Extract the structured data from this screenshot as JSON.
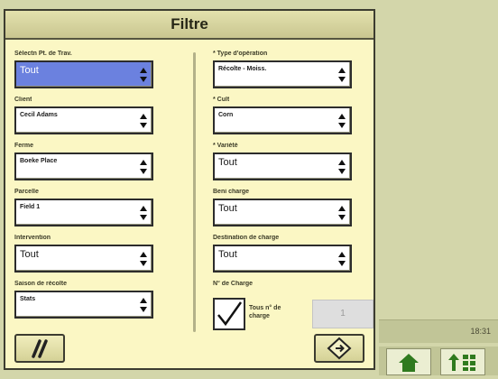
{
  "dialog": {
    "title": "Filtre"
  },
  "left_column": [
    {
      "label": "Sélectn Pt. de Trav.",
      "value": "Tout",
      "active": true
    },
    {
      "label": "Client",
      "value": "Cecil Adams",
      "small": true
    },
    {
      "label": "Ferme",
      "value": "Boeke Place",
      "small": true
    },
    {
      "label": "Parcelle",
      "value": "Field 1",
      "small": true
    },
    {
      "label": "Intervention",
      "value": "Tout"
    },
    {
      "label": "Saison de récolte",
      "value": "Stats",
      "small": true
    }
  ],
  "right_column": [
    {
      "label": "* Type d'opération",
      "value": "Récolte - Moiss.",
      "small": true
    },
    {
      "label": "* Cult",
      "value": "Corn",
      "small": true
    },
    {
      "label": "* Variété",
      "value": "Tout"
    },
    {
      "label": "Beni charge",
      "value": "Tout"
    },
    {
      "label": "Destination de charge",
      "value": "Tout"
    }
  ],
  "load_number": {
    "label": "N° de Charge",
    "checkbox_label": "Tous n° de charge",
    "checked": true,
    "value": "1"
  },
  "status": {
    "clock": "18:31"
  },
  "colors": {
    "panel_bg": "#fbf7c4",
    "active_field": "#6b81df",
    "nav_icon": "#2f7a1e"
  }
}
